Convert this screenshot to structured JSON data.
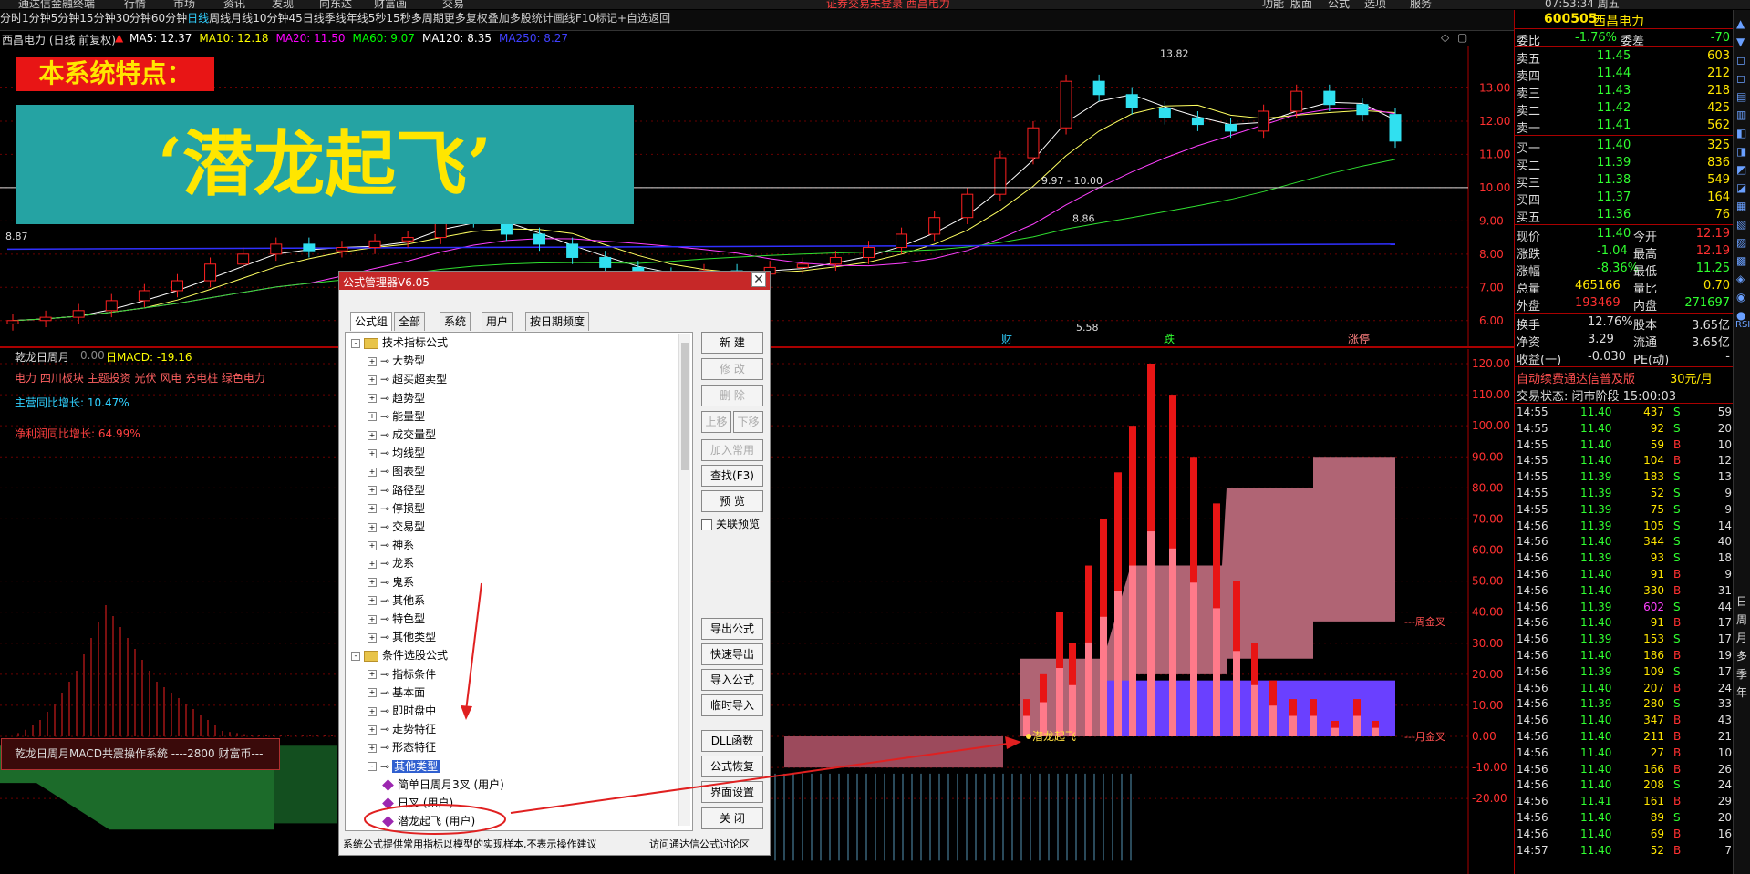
{
  "top_menu": [
    "通达信金融终端",
    "行情",
    "市场",
    "资讯",
    "发现",
    "向东达",
    "财富画",
    "交易",
    "证券交易未登录 西昌电力",
    "功能",
    "版面",
    "公式",
    "选项",
    "服务",
    "07:53:34 周五"
  ],
  "period_bar": {
    "items": [
      "分时",
      "1分钟",
      "5分钟",
      "15分钟",
      "30分钟",
      "60分钟",
      "日线",
      "周线",
      "月线",
      "10分钟",
      "45日线",
      "季线",
      "年线",
      "5秒",
      "15秒",
      "多周期",
      "更多"
    ],
    "active": "日线",
    "right_items": [
      "复权",
      "叠加",
      "多股",
      "统计",
      "画线",
      "F10",
      "标记",
      "+自选",
      "返回"
    ]
  },
  "info_line": {
    "name": "西昌电力 (日线 前复权)",
    "ma": [
      {
        "label": "MA5: 12.37",
        "color": "#ffffff"
      },
      {
        "label": "MA10: 12.18",
        "color": "#ffff00"
      },
      {
        "label": "MA20: 11.50",
        "color": "#ff00ff"
      },
      {
        "label": "MA60: 9.07",
        "color": "#00ff00"
      },
      {
        "label": "MA120: 8.35",
        "color": "#ffffff"
      },
      {
        "label": "MA250: 8.27",
        "color": "#4040ff"
      }
    ]
  },
  "banner": {
    "label": "本系统特点：",
    "title": "‘潜龙起飞’"
  },
  "main_chart": {
    "price_axis": [
      "13.00",
      "12.00",
      "11.00",
      "10.00",
      "9.00",
      "8.00",
      "7.00",
      "6.00"
    ],
    "annotations": [
      "13.82",
      "9.97 - 10.00",
      "8.86",
      "8.87",
      "5.58"
    ],
    "markers": [
      "财",
      "跌",
      "涨停"
    ]
  },
  "sub_chart": {
    "title": "乾龙日周月",
    "value": "0.00",
    "macd_label": "日MACD: -19.16",
    "sectors": "电力 四川板块 主题投资 光伏 风电 充电桩 绿色电力",
    "revenue_growth": "主营同比增长: 10.47%",
    "profit_growth": "净利润同比增长: 64.99%",
    "axis": [
      "120.00",
      "110.00",
      "100.00",
      "90.00",
      "80.00",
      "70.00",
      "60.00",
      "50.00",
      "40.00",
      "30.00",
      "20.00",
      "10.00",
      "0.00",
      "-10.00",
      "-20.00"
    ],
    "week_label": "---周金叉",
    "month_label": "---月金叉",
    "signal_text": "潜龙起飞",
    "legend": "乾龙日周月MACD共震操作系统 ----2800 财富币---"
  },
  "chart_data": {
    "type": "candlestick",
    "title": "西昌电力 (日线 前复权)",
    "ylim": [
      5.5,
      14
    ],
    "annotations": [
      {
        "label": "13.82",
        "value": 13.82
      },
      {
        "label": "5.58",
        "value": 5.58
      },
      {
        "label": "9.97 - 10.00",
        "value": 10.0
      },
      {
        "label": "8.86",
        "value": 8.86
      },
      {
        "label": "8.87",
        "value": 8.87
      }
    ],
    "closes": [
      6.0,
      6.1,
      6.3,
      6.6,
      6.9,
      7.2,
      7.7,
      8.0,
      8.3,
      8.1,
      8.2,
      8.4,
      8.5,
      9.3,
      9.0,
      8.6,
      8.3,
      7.9,
      7.6,
      7.4,
      7.3,
      7.5,
      7.4,
      7.6,
      7.7,
      7.9,
      8.2,
      8.6,
      9.1,
      9.8,
      10.9,
      11.8,
      13.2,
      12.8,
      12.4,
      12.1,
      11.9,
      11.7,
      12.3,
      12.9,
      12.5,
      12.2,
      11.4
    ]
  },
  "right_panel": {
    "code": "600505",
    "name": "西昌电力",
    "weibi": {
      "label": "委比",
      "value": "-1.76%",
      "diff_label": "委差",
      "diff": "-70"
    },
    "asks": [
      {
        "label": "卖五",
        "price": "11.45",
        "vol": "603"
      },
      {
        "label": "卖四",
        "price": "11.44",
        "vol": "212"
      },
      {
        "label": "卖三",
        "price": "11.43",
        "vol": "218"
      },
      {
        "label": "卖二",
        "price": "11.42",
        "vol": "425"
      },
      {
        "label": "卖一",
        "price": "11.41",
        "vol": "562"
      }
    ],
    "bids": [
      {
        "label": "买一",
        "price": "11.40",
        "vol": "325"
      },
      {
        "label": "买二",
        "price": "11.39",
        "vol": "836"
      },
      {
        "label": "买三",
        "price": "11.38",
        "vol": "549"
      },
      {
        "label": "买四",
        "price": "11.37",
        "vol": "164"
      },
      {
        "label": "买五",
        "price": "11.36",
        "vol": "76"
      }
    ],
    "quote": [
      {
        "l1": "现价",
        "v1": "11.40",
        "l2": "今开",
        "v2": "12.19"
      },
      {
        "l1": "涨跌",
        "v1": "-1.04",
        "l2": "最高",
        "v2": "12.19"
      },
      {
        "l1": "涨幅",
        "v1": "-8.36%",
        "l2": "最低",
        "v2": "11.25"
      },
      {
        "l1": "总量",
        "v1": "465166",
        "l2": "量比",
        "v2": "0.70"
      },
      {
        "l1": "外盘",
        "v1": "193469",
        "l2": "内盘",
        "v2": "271697"
      }
    ],
    "stats": [
      {
        "l1": "换手",
        "v1": "12.76%",
        "l2": "股本",
        "v2": "3.65亿"
      },
      {
        "l1": "净资",
        "v1": "3.29",
        "l2": "流通",
        "v2": "3.65亿"
      },
      {
        "l1": "收益(一)",
        "v1": "-0.030",
        "l2": "PE(动)",
        "v2": "-"
      }
    ],
    "promo": "自动续费通达信普及版",
    "promo_price": "30元/月",
    "status": "交易状态: 闭市阶段 15:00:03",
    "ticks": [
      {
        "t": "14:55",
        "p": "11.40",
        "v": "437",
        "s": "S",
        "n": "59"
      },
      {
        "t": "14:55",
        "p": "11.40",
        "v": "92",
        "s": "S",
        "n": "20"
      },
      {
        "t": "14:55",
        "p": "11.40",
        "v": "59",
        "s": "B",
        "n": "10"
      },
      {
        "t": "14:55",
        "p": "11.40",
        "v": "104",
        "s": "B",
        "n": "12"
      },
      {
        "t": "14:55",
        "p": "11.39",
        "v": "183",
        "s": "S",
        "n": "13"
      },
      {
        "t": "14:55",
        "p": "11.39",
        "v": "52",
        "s": "S",
        "n": "9"
      },
      {
        "t": "14:55",
        "p": "11.39",
        "v": "75",
        "s": "S",
        "n": "9"
      },
      {
        "t": "14:56",
        "p": "11.39",
        "v": "105",
        "s": "S",
        "n": "14"
      },
      {
        "t": "14:56",
        "p": "11.40",
        "v": "344",
        "s": "S",
        "n": "40"
      },
      {
        "t": "14:56",
        "p": "11.39",
        "v": "93",
        "s": "S",
        "n": "18"
      },
      {
        "t": "14:56",
        "p": "11.40",
        "v": "91",
        "s": "B",
        "n": "9"
      },
      {
        "t": "14:56",
        "p": "11.40",
        "v": "330",
        "s": "B",
        "n": "31"
      },
      {
        "t": "14:56",
        "p": "11.39",
        "v": "602",
        "s": "S",
        "n": "44"
      },
      {
        "t": "14:56",
        "p": "11.40",
        "v": "91",
        "s": "B",
        "n": "17"
      },
      {
        "t": "14:56",
        "p": "11.39",
        "v": "153",
        "s": "S",
        "n": "17"
      },
      {
        "t": "14:56",
        "p": "11.40",
        "v": "186",
        "s": "B",
        "n": "19"
      },
      {
        "t": "14:56",
        "p": "11.39",
        "v": "109",
        "s": "S",
        "n": "17"
      },
      {
        "t": "14:56",
        "p": "11.40",
        "v": "207",
        "s": "B",
        "n": "24"
      },
      {
        "t": "14:56",
        "p": "11.39",
        "v": "280",
        "s": "S",
        "n": "33"
      },
      {
        "t": "14:56",
        "p": "11.40",
        "v": "347",
        "s": "B",
        "n": "43"
      },
      {
        "t": "14:56",
        "p": "11.40",
        "v": "211",
        "s": "B",
        "n": "21"
      },
      {
        "t": "14:56",
        "p": "11.40",
        "v": "27",
        "s": "B",
        "n": "10"
      },
      {
        "t": "14:56",
        "p": "11.40",
        "v": "166",
        "s": "B",
        "n": "26"
      },
      {
        "t": "14:56",
        "p": "11.40",
        "v": "208",
        "s": "S",
        "n": "24"
      },
      {
        "t": "14:56",
        "p": "11.41",
        "v": "161",
        "s": "B",
        "n": "29"
      },
      {
        "t": "14:56",
        "p": "11.40",
        "v": "89",
        "s": "S",
        "n": "20"
      },
      {
        "t": "14:56",
        "p": "11.40",
        "v": "69",
        "s": "B",
        "n": "16"
      },
      {
        "t": "14:57",
        "p": "11.40",
        "v": "52",
        "s": "B",
        "n": "7"
      }
    ]
  },
  "right_bar_text": "日周月多季年",
  "dialog": {
    "title": "公式管理器V6.05",
    "tabs": [
      "公式组",
      "全部",
      "系统",
      "用户",
      "按日期频度"
    ],
    "tree": [
      {
        "lvl": 0,
        "exp": "-",
        "folder": true,
        "label": "技术指标公式"
      },
      {
        "lvl": 1,
        "exp": "+",
        "label": "大势型"
      },
      {
        "lvl": 1,
        "exp": "+",
        "label": "超买超卖型"
      },
      {
        "lvl": 1,
        "exp": "+",
        "label": "趋势型"
      },
      {
        "lvl": 1,
        "exp": "+",
        "label": "能量型"
      },
      {
        "lvl": 1,
        "exp": "+",
        "label": "成交量型"
      },
      {
        "lvl": 1,
        "exp": "+",
        "label": "均线型"
      },
      {
        "lvl": 1,
        "exp": "+",
        "label": "图表型"
      },
      {
        "lvl": 1,
        "exp": "+",
        "label": "路径型"
      },
      {
        "lvl": 1,
        "exp": "+",
        "label": "停损型"
      },
      {
        "lvl": 1,
        "exp": "+",
        "label": "交易型"
      },
      {
        "lvl": 1,
        "exp": "+",
        "label": "神系"
      },
      {
        "lvl": 1,
        "exp": "+",
        "label": "龙系"
      },
      {
        "lvl": 1,
        "exp": "+",
        "label": "鬼系"
      },
      {
        "lvl": 1,
        "exp": "+",
        "label": "其他系"
      },
      {
        "lvl": 1,
        "exp": "+",
        "label": "特色型"
      },
      {
        "lvl": 1,
        "exp": "+",
        "label": "其他类型"
      },
      {
        "lvl": 0,
        "exp": "-",
        "folder": true,
        "label": "条件选股公式"
      },
      {
        "lvl": 1,
        "exp": "+",
        "label": "指标条件"
      },
      {
        "lvl": 1,
        "exp": "+",
        "label": "基本面"
      },
      {
        "lvl": 1,
        "exp": "+",
        "label": "即时盘中"
      },
      {
        "lvl": 1,
        "exp": "+",
        "label": "走势特征"
      },
      {
        "lvl": 1,
        "exp": "+",
        "label": "形态特征"
      },
      {
        "lvl": 1,
        "exp": "-",
        "label": "其他类型",
        "selected": true
      },
      {
        "lvl": 2,
        "leaf": true,
        "label": "简单日周月3叉 (用户)"
      },
      {
        "lvl": 2,
        "leaf": true,
        "label": "日叉 (用户)"
      },
      {
        "lvl": 2,
        "leaf": true,
        "label": "潜龙起飞 (用户)"
      }
    ],
    "buttons": [
      {
        "label": "新 建",
        "disabled": false
      },
      {
        "label": "修 改",
        "disabled": true
      },
      {
        "label": "删 除",
        "disabled": true
      },
      {
        "label": "上移",
        "disabled": true
      },
      {
        "label": "下移",
        "disabled": true
      },
      {
        "label": "加入常用",
        "disabled": true
      },
      {
        "label": "查找(F3)",
        "disabled": false
      },
      {
        "label": "预 览",
        "disabled": false
      },
      {
        "label": "关联预览",
        "checkbox": true
      },
      {
        "label": "导出公式",
        "disabled": false
      },
      {
        "label": "快速导出",
        "disabled": false
      },
      {
        "label": "导入公式",
        "disabled": false
      },
      {
        "label": "临时导入",
        "disabled": false
      },
      {
        "label": "DLL函数",
        "disabled": false
      },
      {
        "label": "公式恢复",
        "disabled": false
      },
      {
        "label": "界面设置",
        "disabled": false
      },
      {
        "label": "关 闭",
        "disabled": false
      }
    ],
    "footer_left": "系统公式提供常用指标以模型的实现样本,不表示操作建议",
    "footer_right": "访问通达信公式讨论区"
  },
  "colors": {
    "up": "#ff2020",
    "down": "#30e0f0",
    "bg": "#000000",
    "grid": "#7a0000"
  }
}
